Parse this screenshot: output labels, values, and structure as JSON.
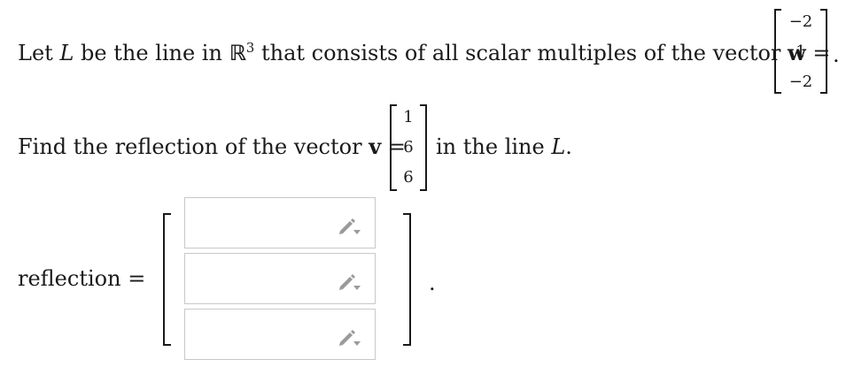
{
  "line1": {
    "prefix": "Let",
    "L": "L",
    "mid1": "be the line in",
    "R": "ℝ",
    "exp": "3",
    "mid2": "that consists of all scalar multiples of the vector",
    "w": "w",
    "eq": "=",
    "period": "."
  },
  "w_vector": [
    "−2",
    "1",
    "−2"
  ],
  "line2": {
    "prefix": "Find the reflection of the vector",
    "v": "v",
    "eq": "=",
    "suffix": "in the line",
    "L": "L",
    "period": "."
  },
  "v_vector": [
    "1",
    "6",
    "6"
  ],
  "answer": {
    "label": "reflection",
    "eq": "=",
    "values": [
      "",
      "",
      ""
    ],
    "period": "."
  },
  "icons": {
    "pencil": "pencil-icon"
  },
  "colors": {
    "input_border": "#c8c8c8",
    "icon": "#9a9a9a"
  }
}
